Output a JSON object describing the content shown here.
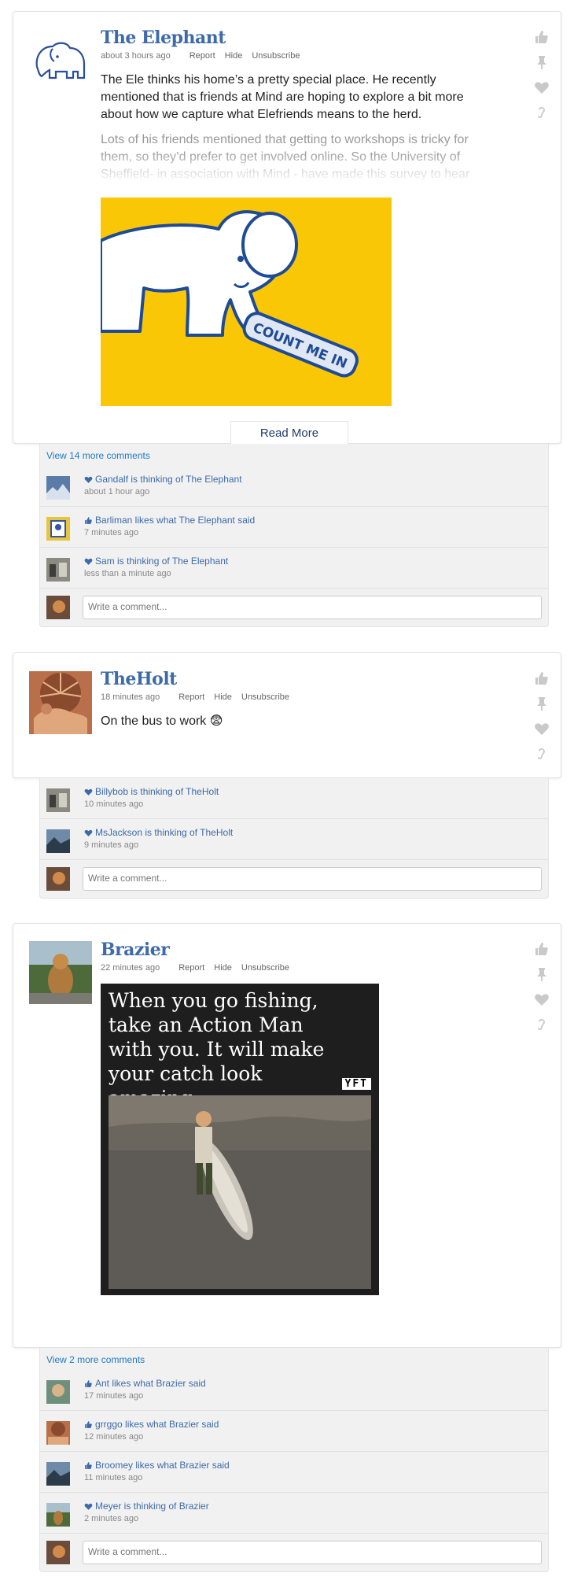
{
  "colors": {
    "name": "#3d6aa8",
    "link": "#1f7ac6",
    "icon": "#c9c9c9"
  },
  "meta_links": {
    "report": "Report",
    "hide": "Hide",
    "unsubscribe": "Unsubscribe"
  },
  "comment_placeholder": "Write a comment...",
  "posts": [
    {
      "name": "The Elephant",
      "time": "about 3 hours ago",
      "text": "The Ele thinks his home’s a pretty special place. He recently mentioned that is friends at Mind are hoping to explore a bit more about how we capture what Elefriends means to the herd.",
      "text_fade": "Lots of his friends mentioned that getting to workshops is tricky for them, so they’d prefer to get involved online. So the University of Sheffield- in association with Mind - have made this survey to hear more about your",
      "image_caption": "COUNT ME IN",
      "read_more": "Read More",
      "more_comments": "View 14 more comments",
      "comments": [
        {
          "text": "Gandalf is thinking of The Elephant",
          "icon": "heart-icon",
          "time": "about 1 hour ago"
        },
        {
          "text": "Barliman likes what The Elephant said",
          "icon": "thumbs-up-icon",
          "time": "7 minutes ago"
        },
        {
          "text": "Sam is thinking of The Elephant",
          "icon": "heart-icon",
          "time": "less than a minute ago"
        }
      ]
    },
    {
      "name": "TheHolt",
      "time": "18 minutes ago",
      "text": "On the bus to work 😨",
      "comments": [
        {
          "text": "Billybob is thinking of TheHolt",
          "icon": "heart-icon",
          "time": "10 minutes ago"
        },
        {
          "text": "MsJackson is thinking of TheHolt",
          "icon": "heart-icon",
          "time": "9 minutes ago"
        }
      ]
    },
    {
      "name": "Brazier",
      "time": "22 minutes ago",
      "meme_text": "When you go fishing, take an Action Man with you. It will make your catch look amazing...",
      "meme_badge": "YFT",
      "more_comments": "View 2 more comments",
      "comments": [
        {
          "text": "Ant likes what Brazier said",
          "icon": "thumbs-up-icon",
          "time": "17 minutes ago"
        },
        {
          "text": "grrggo likes what Brazier said",
          "icon": "thumbs-up-icon",
          "time": "12 minutes ago"
        },
        {
          "text": "Broomey likes what Brazier said",
          "icon": "thumbs-up-icon",
          "time": "11 minutes ago"
        },
        {
          "text": "Meyer is thinking of Brazier",
          "icon": "heart-icon",
          "time": "2 minutes ago"
        }
      ]
    }
  ]
}
